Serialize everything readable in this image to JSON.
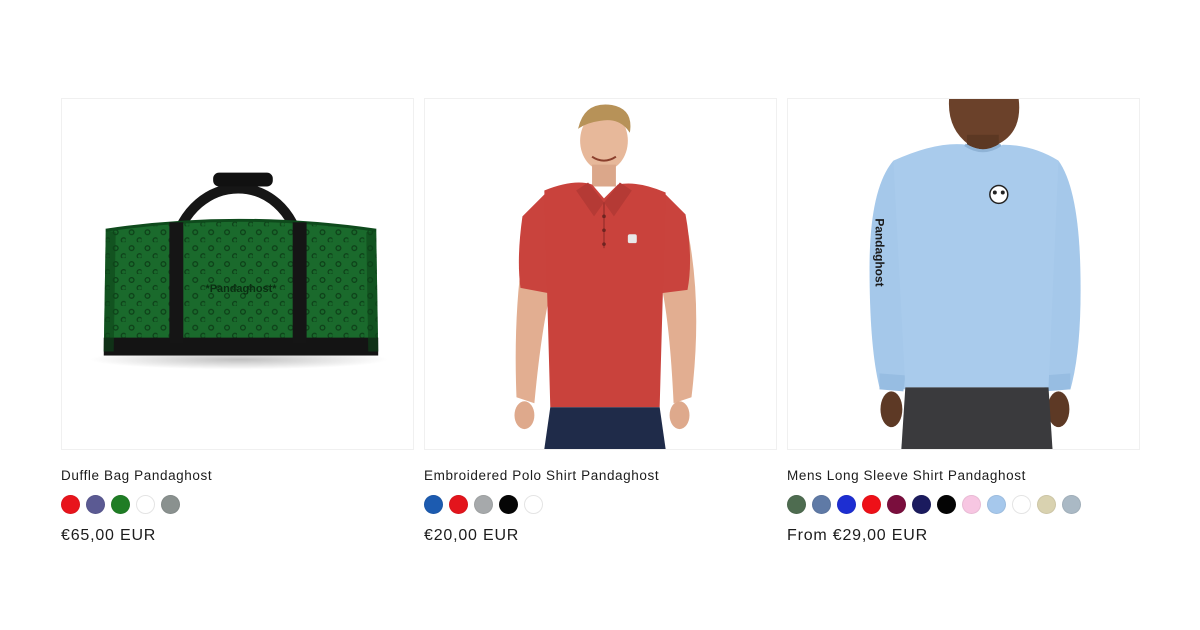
{
  "products": [
    {
      "title": "Duffle Bag Pandaghost",
      "price": "€65,00 EUR",
      "image_alt": "Green duffle bag",
      "bag_print": "*Pandaghost*",
      "swatches": [
        "#e8141c",
        "#5b5a93",
        "#1f7d25",
        "#ffffff",
        "#8a918f"
      ]
    },
    {
      "title": "Embroidered Polo Shirt Pandaghost",
      "price": "€20,00 EUR",
      "image_alt": "Man wearing red polo shirt",
      "swatches": [
        "#1c5bb0",
        "#e3141c",
        "#a6a9ab",
        "#050505",
        "#ffffff"
      ]
    },
    {
      "title": "Mens Long Sleeve Shirt Pandaghost",
      "price": "From €29,00 EUR",
      "image_alt": "Man wearing light blue long sleeve shirt",
      "sleeve_print": "Pandaghost",
      "swatches": [
        "#4e6c50",
        "#5f7aa6",
        "#1d2ed2",
        "#ee1018",
        "#7a0e3d",
        "#1b1b5e",
        "#040404",
        "#f7c6e2",
        "#a6c8ec",
        "#ffffff",
        "#d9d2b0",
        "#aab9c5"
      ]
    }
  ]
}
